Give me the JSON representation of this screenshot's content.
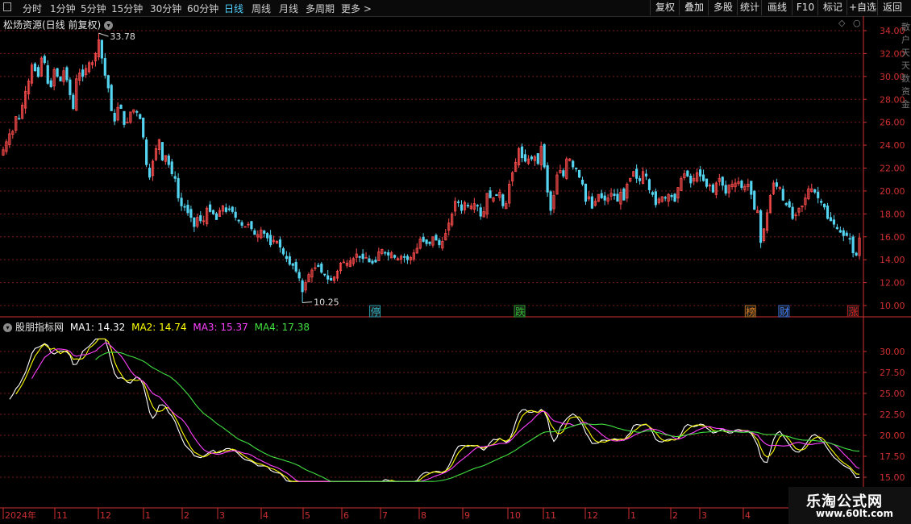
{
  "toolbar": {
    "periods": [
      "分时",
      "1分钟",
      "5分钟",
      "15分钟",
      "30分钟",
      "60分钟",
      "日线",
      "周线",
      "月线",
      "多周期",
      "更多 >"
    ],
    "active_period": "日线",
    "buttons": [
      "复权",
      "叠加",
      "多股",
      "统计",
      "画线",
      "F10",
      "标记",
      "+自选",
      "返回"
    ]
  },
  "main_chart": {
    "title": "松炀资源(日线 前复权)",
    "high_label": "33.78",
    "low_label": "10.25",
    "y_ticks": [
      "34.00",
      "32.00",
      "30.00",
      "28.00",
      "26.00",
      "24.00",
      "22.00",
      "20.00",
      "18.00",
      "16.00",
      "14.00",
      "12.00",
      "10.00"
    ],
    "markers": [
      {
        "text": "停",
        "color": "#2fb8c8"
      },
      {
        "text": "跌",
        "color": "#30c030"
      },
      {
        "text": "榜",
        "color": "#e08020"
      },
      {
        "text": "财",
        "color": "#4080ff"
      },
      {
        "text": "涨",
        "color": "#e02020"
      }
    ],
    "right_edge_text": "散户天天数资金"
  },
  "indicator": {
    "name": "股朋指标网",
    "ma1_label": "MA1: 14.32",
    "ma2_label": "MA2: 14.74",
    "ma3_label": "MA3: 15.37",
    "ma4_label": "MA4: 17.38",
    "y_ticks": [
      "30.00",
      "27.50",
      "25.00",
      "22.50",
      "20.00",
      "17.50",
      "15.00"
    ]
  },
  "date_axis": {
    "labels": [
      "2024年",
      "11",
      "12",
      "1",
      "2",
      "3",
      "4",
      "5",
      "6",
      "7",
      "8",
      "9",
      "10",
      "11",
      "12",
      "1",
      "2",
      "3",
      "4"
    ]
  },
  "watermark": {
    "title": "乐淘公式网",
    "url": "www.60lt.com"
  },
  "colors": {
    "up": "#ff4d4d",
    "down": "#54d4f0",
    "ma1": "#ffffff",
    "ma2": "#ffff00",
    "ma3": "#ff40ff",
    "ma4": "#40e040",
    "grid": "#7a1a1a",
    "axis": "#d03030",
    "active_tab": "#4fd0ff"
  },
  "chart_data": {
    "type": "candlestick",
    "x_start": "2024年",
    "close": [
      23.6,
      24.3,
      25,
      25.2,
      26.5,
      26.3,
      27.5,
      28.7,
      29.6,
      31,
      30.5,
      30,
      31.6,
      31.2,
      29.4,
      29.1,
      30.6,
      30,
      29.6,
      30.5,
      29.7,
      28.4,
      27.2,
      29.8,
      30.3,
      30,
      30.7,
      31.2,
      31.2,
      32,
      33.2,
      31.6,
      30.1,
      29,
      27,
      26.1,
      27.3,
      27.2,
      25.8,
      26,
      26.9,
      27.1,
      26.9,
      26.3,
      24.7,
      22.3,
      21.2,
      22.6,
      23.7,
      24.5,
      22.7,
      23.1,
      22.3,
      21.5,
      21.1,
      19.4,
      18.7,
      18.6,
      18.1,
      17.7,
      16.9,
      17.7,
      17.4,
      17.4,
      18.5,
      18.2,
      18,
      17.5,
      18.3,
      18.7,
      18.2,
      18.4,
      18.2,
      17.7,
      17.4,
      17,
      16.9,
      17.1,
      16.7,
      16.2,
      16.2,
      16.6,
      16.3,
      15.9,
      15.3,
      15.7,
      15.6,
      15.1,
      14.5,
      14.1,
      13.6,
      13.5,
      13,
      12.4,
      11.2,
      12,
      12.7,
      13.1,
      13.3,
      13.4,
      12.9,
      12.7,
      12.3,
      12.2,
      12.5,
      13,
      13.7,
      13.8,
      13.7,
      13.9,
      14.1,
      14.5,
      14.2,
      14.1,
      14.2,
      13.8,
      13.7,
      13.8,
      14.7,
      14.9,
      14.6,
      14.4,
      14.6,
      14.2,
      14.1,
      14.3,
      14.2,
      14,
      14.2,
      14.6,
      15,
      15.8,
      15.6,
      15.4,
      15.4,
      16,
      15.7,
      15.3,
      15.6,
      16.3,
      17.2,
      18,
      19.1,
      19,
      18.3,
      19,
      18.7,
      18.7,
      18.9,
      18.7,
      17.8,
      18.2,
      19.8,
      19.4,
      19.4,
      19.6,
      19.9,
      18.7,
      18.9,
      20.6,
      21.6,
      22.5,
      23.7,
      22.9,
      22.6,
      22.8,
      22.8,
      23,
      22.4,
      23.9,
      22.1,
      19.9,
      18.3,
      19.6,
      21.4,
      21.8,
      21.3,
      22.8,
      22.8,
      22.1,
      22,
      21.2,
      20.6,
      19.1,
      19.5,
      18.5,
      19.1,
      19.7,
      19.4,
      19.2,
      19.4,
      19.8,
      19.6,
      19.1,
      19.9,
      19.2,
      20.6,
      21.1,
      21.7,
      21.1,
      20.9,
      21.7,
      21.3,
      20.1,
      19.7,
      18.8,
      19.3,
      19.5,
      19.4,
      19.7,
      19.5,
      19.1,
      20.3,
      21.1,
      21.5,
      21.3,
      20.7,
      21.1,
      21.6,
      21.3,
      20.9,
      20.4,
      20.5,
      19.9,
      20.7,
      21.1,
      20.5,
      19.8,
      20.5,
      20.6,
      20.7,
      20.8,
      20.3,
      20.4,
      20.6,
      19.7,
      18.4,
      18.3,
      15.5,
      16.7,
      18.1,
      19.6,
      20.7,
      20.4,
      20.3,
      19.2,
      18.8,
      18.6,
      17.6,
      17.9,
      18.5,
      18.7,
      19.4,
      20.2,
      20.2,
      19.9,
      19.4,
      19,
      18.6,
      17.6,
      17.4,
      17.1,
      16.7,
      16.4,
      16.1,
      16.1,
      15.8,
      14.6,
      14.4,
      15.9
    ],
    "high": 33.78,
    "low": 10.25,
    "ylim": [
      10,
      34.5
    ],
    "indicator_ylim": [
      14.5,
      31.5
    ]
  }
}
